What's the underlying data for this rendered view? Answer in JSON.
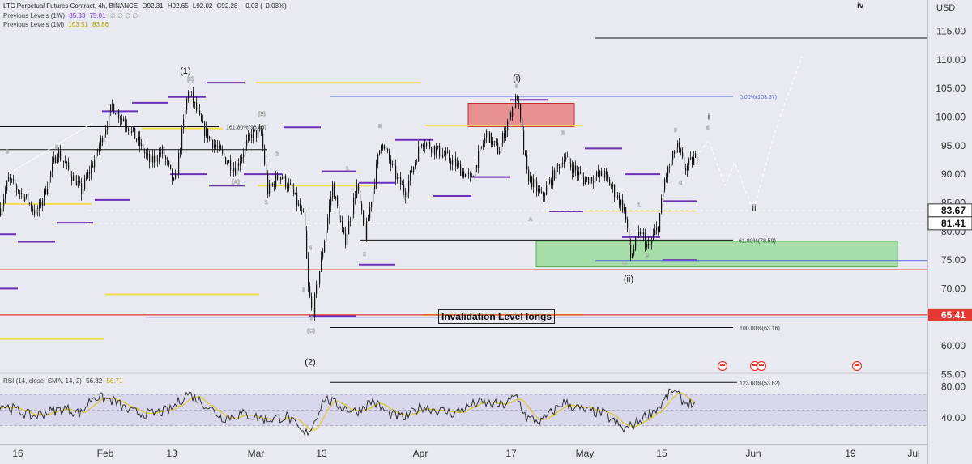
{
  "header": {
    "symbol_line": "LTC Perpetual Futures Contract, 4h, BINANCE",
    "ohlc": [
      "O92.31",
      "H92.65",
      "L92.02",
      "C92.28",
      "−0.03 (−0.03%)"
    ],
    "prev_1w_label": "Previous Levels (1W)",
    "prev_1w_values": [
      "85.33",
      "75.01"
    ],
    "prev_1m_label": "Previous Levels (1M)",
    "prev_1m_values": [
      "103.51",
      "83.86"
    ],
    "currency": "USD",
    "wave_iv": "iv"
  },
  "rsi_header": {
    "label": "RSI (14, close, SMA, 14, 2)",
    "rsi_value": "56.82",
    "sma_value": "56.71"
  },
  "colors": {
    "bg": "#e9eaf1",
    "candle": "#111111",
    "yellow_level": "#f0de4a",
    "purple_level": "#6b2fb6",
    "red_line": "#e53935",
    "blue_line": "#5468d4",
    "red_zone": "#e57373",
    "green_zone": "#8fd88f",
    "rsi": "#222222",
    "rsi_sma": "#d9c93a",
    "rsi_band": "#cbc6e8"
  },
  "chart_data": {
    "type": "line",
    "ylabel": "USD",
    "x_tick_labels": [
      "16",
      "Feb",
      "13",
      "Mar",
      "13",
      "Apr",
      "17",
      "May",
      "15",
      "Jun",
      "19",
      "Jul"
    ],
    "y_tick_labels": [
      "115.00",
      "110.00",
      "105.00",
      "100.00",
      "95.00",
      "90.00",
      "85.00",
      "80.00",
      "75.00",
      "70.00",
      "65.00",
      "60.00",
      "55.00"
    ],
    "ylim": [
      52.5,
      118.5
    ],
    "grid": false,
    "price_labels": [
      {
        "value": 83.67,
        "text": "83.67",
        "style": "boxed"
      },
      {
        "value": 81.41,
        "text": "81.41",
        "style": "boxed"
      },
      {
        "value": 65.41,
        "text": "65.41",
        "style": "red"
      }
    ],
    "waypoints": [
      [
        0,
        84
      ],
      [
        10,
        89
      ],
      [
        30,
        86
      ],
      [
        45,
        83
      ],
      [
        55,
        87
      ],
      [
        70,
        94
      ],
      [
        100,
        87
      ],
      [
        120,
        94
      ],
      [
        138,
        102
      ],
      [
        160,
        98
      ],
      [
        185,
        92
      ],
      [
        200,
        94
      ],
      [
        215,
        88
      ],
      [
        232,
        105
      ],
      [
        250,
        98
      ],
      [
        275,
        93
      ],
      [
        290,
        91
      ],
      [
        310,
        97
      ],
      [
        322,
        97
      ],
      [
        330,
        87
      ],
      [
        345,
        90
      ],
      [
        360,
        87
      ],
      [
        375,
        82
      ],
      [
        380,
        70
      ],
      [
        385,
        65.5
      ],
      [
        395,
        74
      ],
      [
        410,
        88
      ],
      [
        425,
        78
      ],
      [
        440,
        88
      ],
      [
        450,
        79
      ],
      [
        470,
        96
      ],
      [
        490,
        89
      ],
      [
        500,
        87
      ],
      [
        520,
        96
      ],
      [
        540,
        94
      ],
      [
        560,
        92
      ],
      [
        580,
        89
      ],
      [
        600,
        97
      ],
      [
        615,
        94
      ],
      [
        630,
        101
      ],
      [
        638,
        103.5
      ],
      [
        650,
        90
      ],
      [
        668,
        86
      ],
      [
        695,
        93
      ],
      [
        720,
        89
      ],
      [
        745,
        90
      ],
      [
        770,
        84
      ],
      [
        778,
        75.5
      ],
      [
        790,
        80
      ],
      [
        800,
        77
      ],
      [
        812,
        81
      ],
      [
        820,
        89
      ],
      [
        835,
        95
      ],
      [
        845,
        91
      ],
      [
        860,
        93
      ]
    ],
    "projection": [
      [
        860,
        93
      ],
      [
        875,
        96
      ],
      [
        895,
        88
      ],
      [
        907,
        92
      ],
      [
        930,
        83.6
      ],
      [
        958,
        98
      ],
      [
        990,
        110.5
      ]
    ],
    "levels": [
      {
        "color": "yellow",
        "price": 106,
        "x1": 316,
        "x2": 520
      },
      {
        "color": "yellow",
        "price": 98.5,
        "x1": 525,
        "x2": 720
      },
      {
        "color": "yellow",
        "price": 98,
        "x1": 175,
        "x2": 275
      },
      {
        "color": "yellow",
        "price": 88,
        "x1": 318,
        "x2": 465
      },
      {
        "color": "yellow",
        "price": 84.8,
        "x1": 0,
        "x2": 113
      },
      {
        "color": "yellow",
        "price": 83.6,
        "x1": 722,
        "x2": 860
      },
      {
        "color": "yellow",
        "price": 69,
        "x1": 130,
        "x2": 320
      },
      {
        "color": "yellow",
        "price": 65.4,
        "x1": 522,
        "x2": 720
      },
      {
        "color": "yellow",
        "price": 61.2,
        "x1": 0,
        "x2": 128
      },
      {
        "color": "purple",
        "price": 106,
        "x1": 255,
        "x2": 302
      },
      {
        "color": "purple",
        "price": 102.5,
        "x1": 163,
        "x2": 208
      },
      {
        "color": "purple",
        "price": 101,
        "x1": 126,
        "x2": 170
      },
      {
        "color": "purple",
        "price": 103.5,
        "x1": 208,
        "x2": 254
      },
      {
        "color": "purple",
        "price": 98.2,
        "x1": 350,
        "x2": 396
      },
      {
        "color": "purple",
        "price": 96,
        "x1": 488,
        "x2": 535
      },
      {
        "color": "purple",
        "price": 94.5,
        "x1": 722,
        "x2": 768
      },
      {
        "color": "purple",
        "price": 90,
        "x1": 210,
        "x2": 255
      },
      {
        "color": "purple",
        "price": 90,
        "x1": 301,
        "x2": 348
      },
      {
        "color": "purple",
        "price": 90,
        "x1": 771,
        "x2": 815
      },
      {
        "color": "purple",
        "price": 89.5,
        "x1": 582,
        "x2": 630
      },
      {
        "color": "purple",
        "price": 90.5,
        "x1": 398,
        "x2": 440
      },
      {
        "color": "purple",
        "price": 88.5,
        "x1": 443,
        "x2": 488
      },
      {
        "color": "purple",
        "price": 88,
        "x1": 258,
        "x2": 302
      },
      {
        "color": "purple",
        "price": 86.2,
        "x1": 535,
        "x2": 582
      },
      {
        "color": "purple",
        "price": 85.5,
        "x1": 117,
        "x2": 160
      },
      {
        "color": "purple",
        "price": 85.3,
        "x1": 818,
        "x2": 860
      },
      {
        "color": "purple",
        "price": 83.5,
        "x1": 678,
        "x2": 720
      },
      {
        "color": "purple",
        "price": 81.5,
        "x1": 70,
        "x2": 115
      },
      {
        "color": "purple",
        "price": 79.5,
        "x1": 0,
        "x2": 20
      },
      {
        "color": "purple",
        "price": 79,
        "x1": 768,
        "x2": 815
      },
      {
        "color": "purple",
        "price": 78.2,
        "x1": 22,
        "x2": 68
      },
      {
        "color": "purple",
        "price": 74.2,
        "x1": 443,
        "x2": 488
      },
      {
        "color": "purple",
        "price": 75,
        "x1": 818,
        "x2": 860
      },
      {
        "color": "purple",
        "price": 70,
        "x1": 0,
        "x2": 22
      },
      {
        "color": "purple",
        "price": 65.2,
        "x1": 382,
        "x2": 440
      },
      {
        "color": "purple",
        "price": 103,
        "x1": 630,
        "x2": 676
      },
      {
        "color": "black",
        "price": 113.8,
        "x1": 735,
        "x2": 1145
      },
      {
        "color": "black",
        "price": 98.3,
        "x1": 0,
        "x2": 270
      },
      {
        "color": "black",
        "price": 94.3,
        "x1": 0,
        "x2": 330
      },
      {
        "color": "black",
        "price": 78.5,
        "x1": 445,
        "x2": 905
      },
      {
        "color": "black",
        "price": 63.2,
        "x1": 408,
        "x2": 905
      },
      {
        "color": "black",
        "price": 53.6,
        "x1": 408,
        "x2": 910
      },
      {
        "color": "red",
        "price": 73.3,
        "x1": 0,
        "x2": 1145
      },
      {
        "color": "red",
        "price": 65.41,
        "x1": 0,
        "x2": 1145
      },
      {
        "color": "blue",
        "price": 103.6,
        "x1": 408,
        "x2": 905
      },
      {
        "color": "blue",
        "price": 74.9,
        "x1": 735,
        "x2": 1145
      },
      {
        "color": "blue",
        "price": 65.0,
        "x1": 180,
        "x2": 1145
      },
      {
        "color": "dashed",
        "price": 83.67,
        "x1": 108,
        "x2": 1145
      },
      {
        "color": "dashed",
        "price": 81.41,
        "x1": 108,
        "x2": 1145
      }
    ],
    "zones": [
      {
        "color": "red",
        "x1": 578,
        "x2": 709,
        "p1": 102.4,
        "p2": 98.3
      },
      {
        "color": "green",
        "x1": 662,
        "x2": 1108,
        "p1": 78.3,
        "p2": 73.8
      }
    ],
    "wave_labels": [
      {
        "text": "(1)",
        "x": 229,
        "p": 107.6,
        "big": true
      },
      {
        "text": "(5)",
        "x": 235,
        "p": 106.3
      },
      {
        "text": "(i)",
        "x": 638,
        "p": 106.3,
        "big": true
      },
      {
        "text": "5",
        "x": 638,
        "p": 105
      },
      {
        "text": "(2)",
        "x": 383,
        "p": 56.7,
        "big": true
      },
      {
        "text": "5",
        "x": 385,
        "p": 64.5
      },
      {
        "text": "(C)",
        "x": 384,
        "p": 62.3
      },
      {
        "text": "(B)",
        "x": 323,
        "p": 100.2
      },
      {
        "text": "(A)",
        "x": 291,
        "p": 88.3
      },
      {
        "text": "2",
        "x": 342,
        "p": 93.2
      },
      {
        "text": "1",
        "x": 329,
        "p": 84.8
      },
      {
        "text": "4",
        "x": 383,
        "p": 76.8
      },
      {
        "text": "3",
        "x": 375,
        "p": 69.5
      },
      {
        "text": "3",
        "x": 9,
        "p": 93.6
      },
      {
        "text": "5",
        "x": 70,
        "p": 94.4
      },
      {
        "text": "4",
        "x": 47,
        "p": 83.3
      },
      {
        "text": "1",
        "x": 429,
        "p": 90.7
      },
      {
        "text": "2",
        "x": 450,
        "p": 75.7
      },
      {
        "text": "3",
        "x": 469,
        "p": 98.1
      },
      {
        "text": "4",
        "x": 499,
        "p": 85.6
      },
      {
        "text": "B",
        "x": 695,
        "p": 96.9
      },
      {
        "text": "A",
        "x": 655,
        "p": 81.8
      },
      {
        "text": "C",
        "x": 771,
        "p": 74.2
      },
      {
        "text": "1",
        "x": 789,
        "p": 84.3
      },
      {
        "text": "2",
        "x": 799,
        "p": 75.5
      },
      {
        "text": "(ii)",
        "x": 776,
        "p": 71.2,
        "big": true
      },
      {
        "text": "3",
        "x": 834,
        "p": 97.4
      },
      {
        "text": "4",
        "x": 840,
        "p": 88.2
      },
      {
        "text": "i",
        "x": 875,
        "p": 99.6,
        "big": true
      },
      {
        "text": "5",
        "x": 874,
        "p": 97.8
      },
      {
        "text": "ii",
        "x": 931,
        "p": 83.6,
        "big": true
      }
    ],
    "annotations": [
      {
        "text": "161.80%(98.83)",
        "x": 279,
        "p": 98.3,
        "anchor": "start"
      },
      {
        "text": "0.00%(103.57)",
        "x": 913,
        "p": 103.6,
        "anchor": "start"
      },
      {
        "text": "61.80%(78.59)",
        "x": 912,
        "p": 78.5,
        "anchor": "start"
      },
      {
        "text": "100.00%(63.16)",
        "x": 913,
        "p": 63.2,
        "anchor": "start"
      },
      {
        "text": "123.60%(53.62)",
        "x": 913,
        "p": 53.6,
        "anchor": "start"
      }
    ],
    "invalidation_text": "Invalidation Level longs",
    "event_markers_x": [
      892,
      932,
      940,
      1058
    ],
    "rsi": {
      "levels": [
        "80.00",
        "40.00"
      ],
      "band_high": 70,
      "band_low": 30,
      "series_keypoints": [
        [
          0,
          58
        ],
        [
          20,
          50
        ],
        [
          40,
          42
        ],
        [
          60,
          48
        ],
        [
          80,
          52
        ],
        [
          100,
          46
        ],
        [
          115,
          68
        ],
        [
          140,
          62
        ],
        [
          160,
          48
        ],
        [
          185,
          45
        ],
        [
          210,
          50
        ],
        [
          232,
          72
        ],
        [
          250,
          60
        ],
        [
          275,
          40
        ],
        [
          300,
          45
        ],
        [
          330,
          38
        ],
        [
          355,
          42
        ],
        [
          375,
          18
        ],
        [
          385,
          28
        ],
        [
          400,
          65
        ],
        [
          420,
          55
        ],
        [
          440,
          48
        ],
        [
          460,
          62
        ],
        [
          480,
          45
        ],
        [
          500,
          40
        ],
        [
          520,
          55
        ],
        [
          540,
          50
        ],
        [
          560,
          46
        ],
        [
          590,
          60
        ],
        [
          620,
          56
        ],
        [
          638,
          68
        ],
        [
          650,
          40
        ],
        [
          668,
          35
        ],
        [
          695,
          60
        ],
        [
          720,
          50
        ],
        [
          745,
          46
        ],
        [
          770,
          25
        ],
        [
          780,
          30
        ],
        [
          800,
          45
        ],
        [
          815,
          55
        ],
        [
          830,
          76
        ],
        [
          845,
          60
        ],
        [
          858,
          58
        ]
      ]
    }
  }
}
